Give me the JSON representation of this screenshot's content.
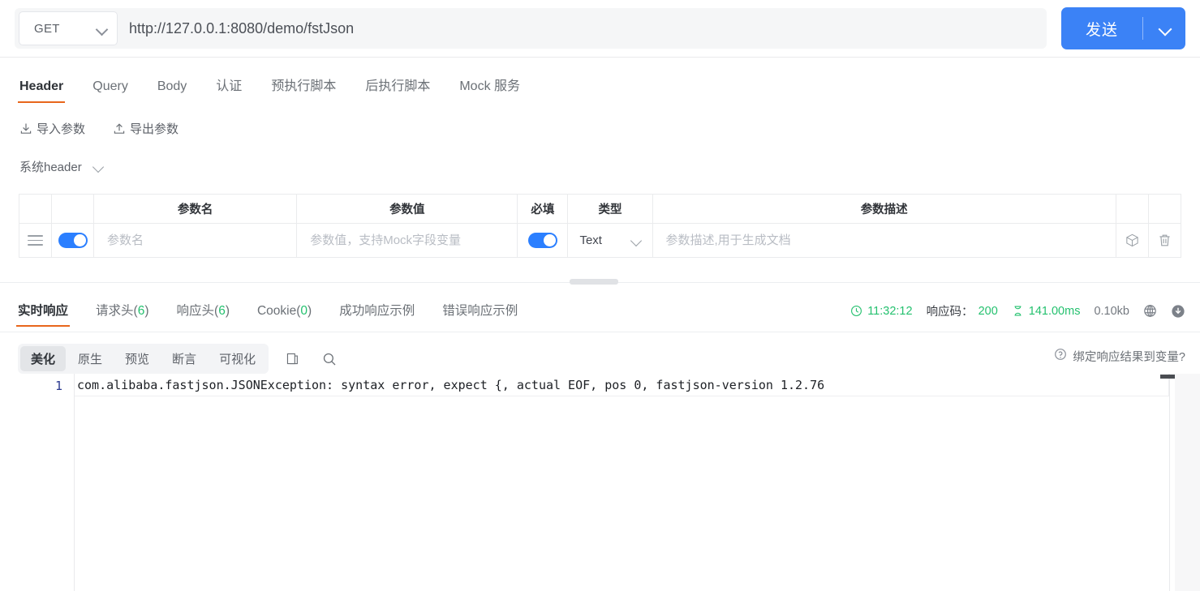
{
  "request": {
    "method": "GET",
    "url": "http://127.0.0.1:8080/demo/fstJson",
    "url_placeholder": "http://",
    "send_label": "发送"
  },
  "request_tabs": [
    {
      "label": "Header",
      "active": true
    },
    {
      "label": "Query",
      "active": false
    },
    {
      "label": "Body",
      "active": false
    },
    {
      "label": "认证",
      "active": false
    },
    {
      "label": "预执行脚本",
      "active": false
    },
    {
      "label": "后执行脚本",
      "active": false
    },
    {
      "label": "Mock 服务",
      "active": false
    }
  ],
  "io_actions": {
    "import_label": "导入参数",
    "export_label": "导出参数"
  },
  "system_header": {
    "label": "系统header"
  },
  "params_table": {
    "headers": {
      "drag": "",
      "enabled": "",
      "name": "参数名",
      "value": "参数值",
      "required": "必填",
      "type": "类型",
      "description": "参数描述",
      "box": "",
      "delete": ""
    },
    "rows": [
      {
        "name_value": "",
        "name_placeholder": "参数名",
        "value_value": "",
        "value_placeholder": "参数值，支持Mock字段变量",
        "type": "Text",
        "desc_value": "",
        "desc_placeholder": "参数描述,用于生成文档",
        "enabled": true,
        "required": true
      }
    ]
  },
  "response_tabs": [
    {
      "label": "实时响应",
      "count": "",
      "active": true
    },
    {
      "label": "请求头",
      "count": "6",
      "active": false
    },
    {
      "label": "响应头",
      "count": "6",
      "active": false
    },
    {
      "label": "Cookie",
      "count": "0",
      "active": false
    },
    {
      "label": "成功响应示例",
      "count": "",
      "active": false
    },
    {
      "label": "错误响应示例",
      "count": "",
      "active": false
    }
  ],
  "status": {
    "time": "11:32:12",
    "code_label": "响应码：",
    "code": "200",
    "duration": "141.00ms",
    "size": "0.10kb"
  },
  "viewer": {
    "segments": [
      {
        "label": "美化",
        "active": true
      },
      {
        "label": "原生",
        "active": false
      },
      {
        "label": "预览",
        "active": false
      },
      {
        "label": "断言",
        "active": false
      },
      {
        "label": "可视化",
        "active": false
      }
    ],
    "bind_label": "绑定响应结果到变量?"
  },
  "response_body": {
    "line_number": "1",
    "text": "com.alibaba.fastjson.JSONException: syntax error, expect {, actual EOF, pos 0, fastjson-version 1.2.76"
  },
  "colors": {
    "accent_orange": "#e8661c",
    "primary_blue": "#3b82f6",
    "success_green": "#25c16f"
  }
}
